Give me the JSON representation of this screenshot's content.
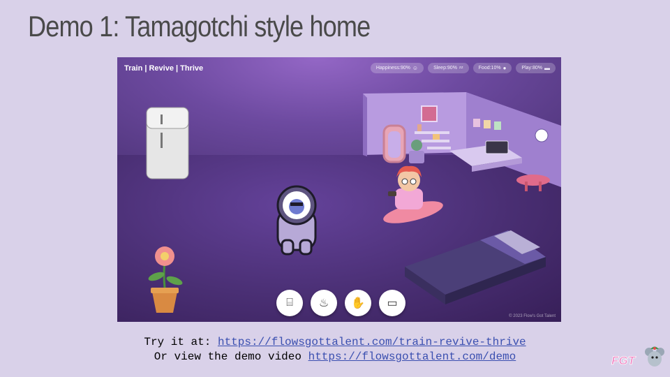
{
  "slide": {
    "title": "Demo 1: Tamagotchi style home"
  },
  "game": {
    "brand": "Train | Revive | Thrive",
    "stats": [
      {
        "label": "Happiness:90%",
        "icon": "smile-icon",
        "glyph": "☺"
      },
      {
        "label": "Sleep:90%",
        "icon": "zzz-icon",
        "glyph": "ᶻᶻ"
      },
      {
        "label": "Food:10%",
        "icon": "food-icon",
        "glyph": "●"
      },
      {
        "label": "Play:80%",
        "icon": "gamepad-icon",
        "glyph": "▬"
      }
    ],
    "actions": [
      {
        "name": "workout-button",
        "icon": "dumbbell-icon",
        "glyph": "⌸"
      },
      {
        "name": "feed-button",
        "icon": "flame-icon",
        "glyph": "♨"
      },
      {
        "name": "play-button",
        "icon": "hand-icon",
        "glyph": "✋"
      },
      {
        "name": "tv-button",
        "icon": "tv-icon",
        "glyph": "▭"
      }
    ],
    "copyright": "© 2023 Flow's Got Talent"
  },
  "captions": {
    "line1_prefix": "Try it at: ",
    "line1_link": "https://flowsgottalent.com/train-revive-thrive",
    "line2_prefix": "Or view the demo video ",
    "line2_link": "https://flowsgottalent.com/demo"
  },
  "logo": {
    "text": "FGT"
  },
  "colors": {
    "slide_bg": "#d9d1e9",
    "link": "#3a4fb0",
    "logo_pink": "#f07fc0"
  }
}
